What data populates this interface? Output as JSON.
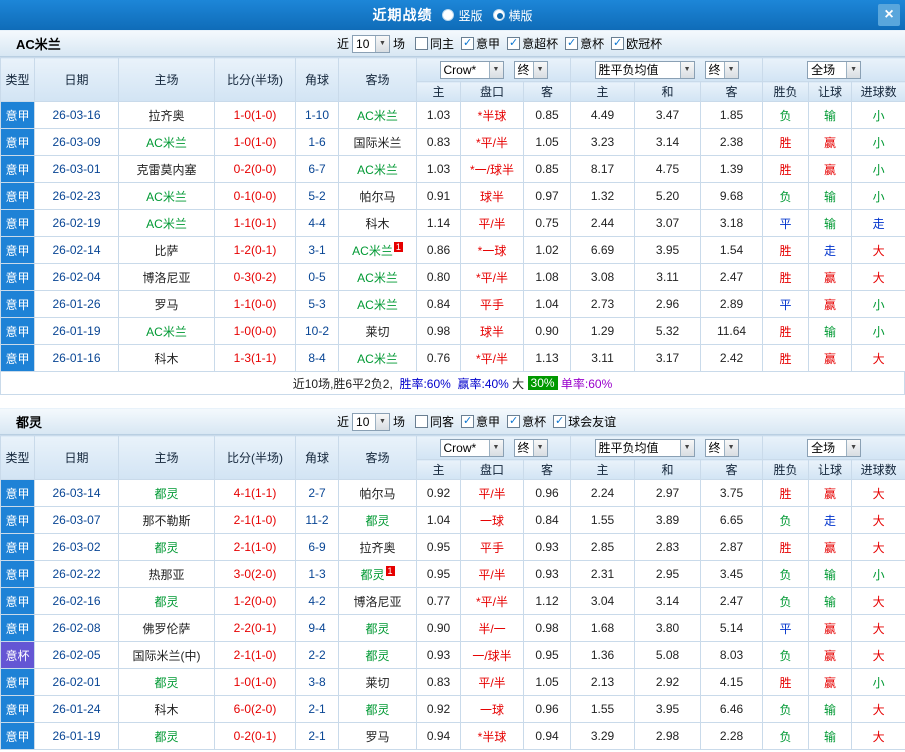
{
  "top_bar": {
    "title": "近期战绩",
    "vertical_label": "竖版",
    "horizontal_label": "横版",
    "selected_layout": "横版",
    "close_glyph": "×"
  },
  "colors": {
    "league": {
      "意甲": "#1e82d6",
      "意杯": "#6456d4"
    },
    "focus_team": "#009933",
    "result": {
      "胜": "#e60000",
      "负": "#009933",
      "平": "#0033cc",
      "赢": "#e60000",
      "输": "#009933",
      "走": "#0033cc",
      "大": "#e60000",
      "小": "#009933"
    },
    "score": "#e60000",
    "handicap": "#e60000",
    "date": "#084594",
    "summary_blue": "#0000cc",
    "summary_purple": "#9900cc",
    "summary_badge_bg": "#009900",
    "rank_badge_bg": "#e60000",
    "titlebar_bg": "#1377c6"
  },
  "table_header": {
    "main_cols": [
      "类型",
      "日期",
      "主场",
      "比分(半场)",
      "角球",
      "客场"
    ],
    "odds_source": "Crow*",
    "odds_final": "终",
    "odds_cols": [
      "主",
      "盘口",
      "客"
    ],
    "wdl_source": "胜平负均值",
    "wdl_final": "终",
    "wdl_cols": [
      "主",
      "和",
      "客"
    ],
    "scope": "全场",
    "result_cols": [
      "胜负",
      "让球",
      "进球数"
    ]
  },
  "sections": [
    {
      "id": "ac-milan",
      "team": "AC米兰",
      "filters": {
        "near_label": "近",
        "count": "10",
        "games_label": "场",
        "checkboxes": [
          {
            "label": "同主",
            "checked": false
          },
          {
            "label": "意甲",
            "checked": true
          },
          {
            "label": "意超杯",
            "checked": true
          },
          {
            "label": "意杯",
            "checked": true
          },
          {
            "label": "欧冠杯",
            "checked": true
          }
        ]
      },
      "rows": [
        {
          "league": "意甲",
          "date": "26-03-16",
          "home": "拉齐奥",
          "home_focus": false,
          "score": "1-0(1-0)",
          "corners": "1-10",
          "away": "AC米兰",
          "away_focus": true,
          "odds": [
            "1.03",
            "*半球",
            "0.85"
          ],
          "avg": [
            "4.49",
            "3.47",
            "1.85"
          ],
          "res": [
            "负",
            "输",
            "小"
          ]
        },
        {
          "league": "意甲",
          "date": "26-03-09",
          "home": "AC米兰",
          "home_focus": true,
          "score": "1-0(1-0)",
          "corners": "1-6",
          "away": "国际米兰",
          "away_focus": false,
          "odds": [
            "0.83",
            "*平/半",
            "1.05"
          ],
          "avg": [
            "3.23",
            "3.14",
            "2.38"
          ],
          "res": [
            "胜",
            "赢",
            "小"
          ]
        },
        {
          "league": "意甲",
          "date": "26-03-01",
          "home": "克雷莫内塞",
          "home_focus": false,
          "score": "0-2(0-0)",
          "corners": "6-7",
          "away": "AC米兰",
          "away_focus": true,
          "odds": [
            "1.03",
            "*一/球半",
            "0.85"
          ],
          "avg": [
            "8.17",
            "4.75",
            "1.39"
          ],
          "res": [
            "胜",
            "赢",
            "小"
          ]
        },
        {
          "league": "意甲",
          "date": "26-02-23",
          "home": "AC米兰",
          "home_focus": true,
          "score": "0-1(0-0)",
          "corners": "5-2",
          "away": "帕尔马",
          "away_focus": false,
          "odds": [
            "0.91",
            "球半",
            "0.97"
          ],
          "avg": [
            "1.32",
            "5.20",
            "9.68"
          ],
          "res": [
            "负",
            "输",
            "小"
          ]
        },
        {
          "league": "意甲",
          "date": "26-02-19",
          "home": "AC米兰",
          "home_focus": true,
          "score": "1-1(0-1)",
          "corners": "4-4",
          "away": "科木",
          "away_focus": false,
          "odds": [
            "1.14",
            "平/半",
            "0.75"
          ],
          "avg": [
            "2.44",
            "3.07",
            "3.18"
          ],
          "res": [
            "平",
            "输",
            "走"
          ]
        },
        {
          "league": "意甲",
          "date": "26-02-14",
          "home": "比萨",
          "home_focus": false,
          "score": "1-2(0-1)",
          "corners": "3-1",
          "away": "AC米兰",
          "away_focus": true,
          "away_badge": "1",
          "odds": [
            "0.86",
            "*一球",
            "1.02"
          ],
          "avg": [
            "6.69",
            "3.95",
            "1.54"
          ],
          "res": [
            "胜",
            "走",
            "大"
          ]
        },
        {
          "league": "意甲",
          "date": "26-02-04",
          "home": "博洛尼亚",
          "home_focus": false,
          "score": "0-3(0-2)",
          "corners": "0-5",
          "away": "AC米兰",
          "away_focus": true,
          "odds": [
            "0.80",
            "*平/半",
            "1.08"
          ],
          "avg": [
            "3.08",
            "3.11",
            "2.47"
          ],
          "res": [
            "胜",
            "赢",
            "大"
          ]
        },
        {
          "league": "意甲",
          "date": "26-01-26",
          "home": "罗马",
          "home_focus": false,
          "score": "1-1(0-0)",
          "corners": "5-3",
          "away": "AC米兰",
          "away_focus": true,
          "odds": [
            "0.84",
            "平手",
            "1.04"
          ],
          "avg": [
            "2.73",
            "2.96",
            "2.89"
          ],
          "res": [
            "平",
            "赢",
            "小"
          ]
        },
        {
          "league": "意甲",
          "date": "26-01-19",
          "home": "AC米兰",
          "home_focus": true,
          "score": "1-0(0-0)",
          "corners": "10-2",
          "away": "莱切",
          "away_focus": false,
          "odds": [
            "0.98",
            "球半",
            "0.90"
          ],
          "avg": [
            "1.29",
            "5.32",
            "11.64"
          ],
          "res": [
            "胜",
            "输",
            "小"
          ]
        },
        {
          "league": "意甲",
          "date": "26-01-16",
          "home": "科木",
          "home_focus": false,
          "score": "1-3(1-1)",
          "corners": "8-4",
          "away": "AC米兰",
          "away_focus": true,
          "odds": [
            "0.76",
            "*平/半",
            "1.13"
          ],
          "avg": [
            "3.11",
            "3.17",
            "2.42"
          ],
          "res": [
            "胜",
            "赢",
            "大"
          ]
        }
      ],
      "summary": [
        {
          "text": "近10场,胜6平2负2,  ",
          "style": "plain"
        },
        {
          "text": "胜率:60%",
          "style": "blue"
        },
        {
          "text": "  ",
          "style": "plain"
        },
        {
          "text": "赢率:40%",
          "style": "blue"
        },
        {
          "text": " 大 ",
          "style": "plain"
        },
        {
          "text": "30%",
          "style": "badge"
        },
        {
          "text": " ",
          "style": "plain"
        },
        {
          "text": "单率:60%",
          "style": "purple"
        }
      ]
    },
    {
      "id": "torino",
      "team": "都灵",
      "filters": {
        "near_label": "近",
        "count": "10",
        "games_label": "场",
        "checkboxes": [
          {
            "label": "同客",
            "checked": false
          },
          {
            "label": "意甲",
            "checked": true
          },
          {
            "label": "意杯",
            "checked": true
          },
          {
            "label": "球会友谊",
            "checked": true
          }
        ]
      },
      "rows": [
        {
          "league": "意甲",
          "date": "26-03-14",
          "home": "都灵",
          "home_focus": true,
          "score": "4-1(1-1)",
          "corners": "2-7",
          "away": "帕尔马",
          "away_focus": false,
          "odds": [
            "0.92",
            "平/半",
            "0.96"
          ],
          "avg": [
            "2.24",
            "2.97",
            "3.75"
          ],
          "res": [
            "胜",
            "赢",
            "大"
          ]
        },
        {
          "league": "意甲",
          "date": "26-03-07",
          "home": "那不勒斯",
          "home_focus": false,
          "score": "2-1(1-0)",
          "corners": "11-2",
          "away": "都灵",
          "away_focus": true,
          "odds": [
            "1.04",
            "一球",
            "0.84"
          ],
          "avg": [
            "1.55",
            "3.89",
            "6.65"
          ],
          "res": [
            "负",
            "走",
            "大"
          ]
        },
        {
          "league": "意甲",
          "date": "26-03-02",
          "home": "都灵",
          "home_focus": true,
          "score": "2-1(1-0)",
          "corners": "6-9",
          "away": "拉齐奥",
          "away_focus": false,
          "odds": [
            "0.95",
            "平手",
            "0.93"
          ],
          "avg": [
            "2.85",
            "2.83",
            "2.87"
          ],
          "res": [
            "胜",
            "赢",
            "大"
          ]
        },
        {
          "league": "意甲",
          "date": "26-02-22",
          "home": "热那亚",
          "home_focus": false,
          "score": "3-0(2-0)",
          "corners": "1-3",
          "away": "都灵",
          "away_focus": true,
          "away_badge": "1",
          "odds": [
            "0.95",
            "平/半",
            "0.93"
          ],
          "avg": [
            "2.31",
            "2.95",
            "3.45"
          ],
          "res": [
            "负",
            "输",
            "小"
          ]
        },
        {
          "league": "意甲",
          "date": "26-02-16",
          "home": "都灵",
          "home_focus": true,
          "score": "1-2(0-0)",
          "corners": "4-2",
          "away": "博洛尼亚",
          "away_focus": false,
          "odds": [
            "0.77",
            "*平/半",
            "1.12"
          ],
          "avg": [
            "3.04",
            "3.14",
            "2.47"
          ],
          "res": [
            "负",
            "输",
            "大"
          ]
        },
        {
          "league": "意甲",
          "date": "26-02-08",
          "home": "佛罗伦萨",
          "home_focus": false,
          "score": "2-2(0-1)",
          "corners": "9-4",
          "away": "都灵",
          "away_focus": true,
          "odds": [
            "0.90",
            "半/一",
            "0.98"
          ],
          "avg": [
            "1.68",
            "3.80",
            "5.14"
          ],
          "res": [
            "平",
            "赢",
            "大"
          ]
        },
        {
          "league": "意杯",
          "date": "26-02-05",
          "home": "国际米兰(中)",
          "home_focus": false,
          "score": "2-1(1-0)",
          "corners": "2-2",
          "away": "都灵",
          "away_focus": true,
          "odds": [
            "0.93",
            "一/球半",
            "0.95"
          ],
          "avg": [
            "1.36",
            "5.08",
            "8.03"
          ],
          "res": [
            "负",
            "赢",
            "大"
          ]
        },
        {
          "league": "意甲",
          "date": "26-02-01",
          "home": "都灵",
          "home_focus": true,
          "score": "1-0(1-0)",
          "corners": "3-8",
          "away": "莱切",
          "away_focus": false,
          "odds": [
            "0.83",
            "平/半",
            "1.05"
          ],
          "avg": [
            "2.13",
            "2.92",
            "4.15"
          ],
          "res": [
            "胜",
            "赢",
            "小"
          ]
        },
        {
          "league": "意甲",
          "date": "26-01-24",
          "home": "科木",
          "home_focus": false,
          "score": "6-0(2-0)",
          "corners": "2-1",
          "away": "都灵",
          "away_focus": true,
          "odds": [
            "0.92",
            "一球",
            "0.96"
          ],
          "avg": [
            "1.55",
            "3.95",
            "6.46"
          ],
          "res": [
            "负",
            "输",
            "大"
          ]
        },
        {
          "league": "意甲",
          "date": "26-01-19",
          "home": "都灵",
          "home_focus": true,
          "score": "0-2(0-1)",
          "corners": "2-1",
          "away": "罗马",
          "away_focus": false,
          "odds": [
            "0.94",
            "*半球",
            "0.94"
          ],
          "avg": [
            "3.29",
            "2.98",
            "2.28"
          ],
          "res": [
            "负",
            "输",
            "大"
          ]
        }
      ],
      "summary": null
    }
  ]
}
